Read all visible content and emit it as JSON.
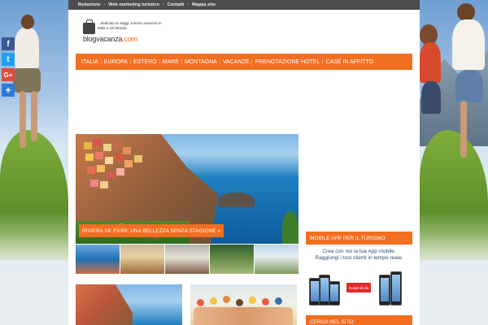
{
  "topbar": {
    "links": [
      "Redazione",
      "Web marketing turistico",
      "Contatti",
      "Mappa sito"
    ],
    "separator": "•"
  },
  "logo": {
    "tagline": "...dedicato ai viaggi, turismo vacanze in Italia e nel Mondo",
    "name_main": "blogvacanza",
    "name_suffix": ".com"
  },
  "nav": {
    "items": [
      "ITALIA",
      "EUROPA",
      "ESTERO",
      "MARE",
      "MONTAGNA",
      "VACANZE",
      "PRENOTAZIONE HOTEL",
      "CASE IN AFFITTO"
    ]
  },
  "share": {
    "buttons": [
      {
        "icon": "facebook-icon",
        "glyph": "f",
        "color": "#3b5998"
      },
      {
        "icon": "twitter-icon",
        "glyph": "t",
        "color": "#1da1f2"
      },
      {
        "icon": "google-plus-icon",
        "glyph": "G+",
        "color": "#dd4b39"
      },
      {
        "icon": "share-plus-icon",
        "glyph": "+",
        "color": "#2e7bd6"
      }
    ]
  },
  "feature": {
    "caption": "RIVIERA DE FIORI: UNA BELLEZZA SENZA STAGIONE",
    "arrow": "»"
  },
  "sidebar": {
    "app_widget_title": "MOBILE APP PER IL TURISMO",
    "app_line1": "Crea con noi la tua App mobile.",
    "app_line2": "Raggiungi i tuoi clienti in tempo reale.",
    "app_cta": "Scopri di più",
    "search_widget_title": "CERCA NEL SITO"
  },
  "colors": {
    "accent": "#f26e21",
    "topbar": "#4d4d4d",
    "background": "#e9eef2"
  }
}
